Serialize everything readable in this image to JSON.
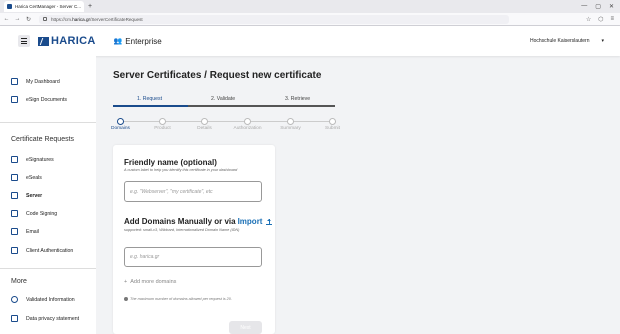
{
  "browser": {
    "tab_title": "Harica CertManager - Server C...",
    "tab_close": "✕",
    "new_tab": "+",
    "window_controls": [
      "—",
      "▢",
      "✕"
    ],
    "url_prefix": "https://cm.",
    "url_host": "harica.gr",
    "url_path": "/ServerCertificateRequest",
    "nav_back": "←",
    "nav_forward": "→",
    "nav_reload": "↻",
    "nav_right_icons": [
      "☆",
      "⬡",
      "≡"
    ]
  },
  "header": {
    "logo_text": "HARICA",
    "product": "Enterprise",
    "organization": "Hochschule Kaiserslautern",
    "org_chevron": "▾",
    "accent_color": "#1a4b8c"
  },
  "sidebar": {
    "items_top": [
      {
        "label": "My Dashboard",
        "icon": "dashboard-icon"
      },
      {
        "label": "eSign Documents",
        "icon": "document-icon"
      }
    ],
    "requests_heading": "Certificate Requests",
    "request_items": [
      {
        "label": "eSignatures",
        "icon": "signature-icon"
      },
      {
        "label": "eSeals",
        "icon": "seal-icon"
      },
      {
        "label": "Server",
        "icon": "lock-icon",
        "active": true
      },
      {
        "label": "Code Signing",
        "icon": "code-icon"
      },
      {
        "label": "Email",
        "icon": "mail-icon"
      },
      {
        "label": "Client Authentication",
        "icon": "id-card-icon"
      }
    ],
    "more_heading": "More",
    "more_items": [
      {
        "label": "Validated Information",
        "icon": "validated-icon"
      },
      {
        "label": "Data privacy statement",
        "icon": "privacy-icon"
      }
    ]
  },
  "main": {
    "title": "Server Certificates / Request new certificate",
    "steps": [
      {
        "label": "1. Request",
        "active": true
      },
      {
        "label": "2. Validate",
        "active": false
      },
      {
        "label": "3. Retrieve",
        "active": false
      }
    ],
    "substeps": [
      "Domains",
      "Product",
      "Details",
      "Authorization",
      "Summary",
      "Submit"
    ],
    "friendly_name": {
      "title": "Friendly name (optional)",
      "help": "A custom label to help you identify this certificate in your dashboard",
      "placeholder": "e.g. \"Webserver\", \"my certificate\", etc"
    },
    "domains": {
      "title": "Add Domains Manually or via",
      "import_label": "Import",
      "supported": "supported: small-v3, Wildcard, Internationalized Domain Name (IDN)",
      "placeholder": "e.g. harica.gr",
      "add_more": "Add more domains",
      "add_more_icon": "+",
      "max_note": "The maximum number of domains allowed per request is 20."
    },
    "next_label": "Next"
  }
}
